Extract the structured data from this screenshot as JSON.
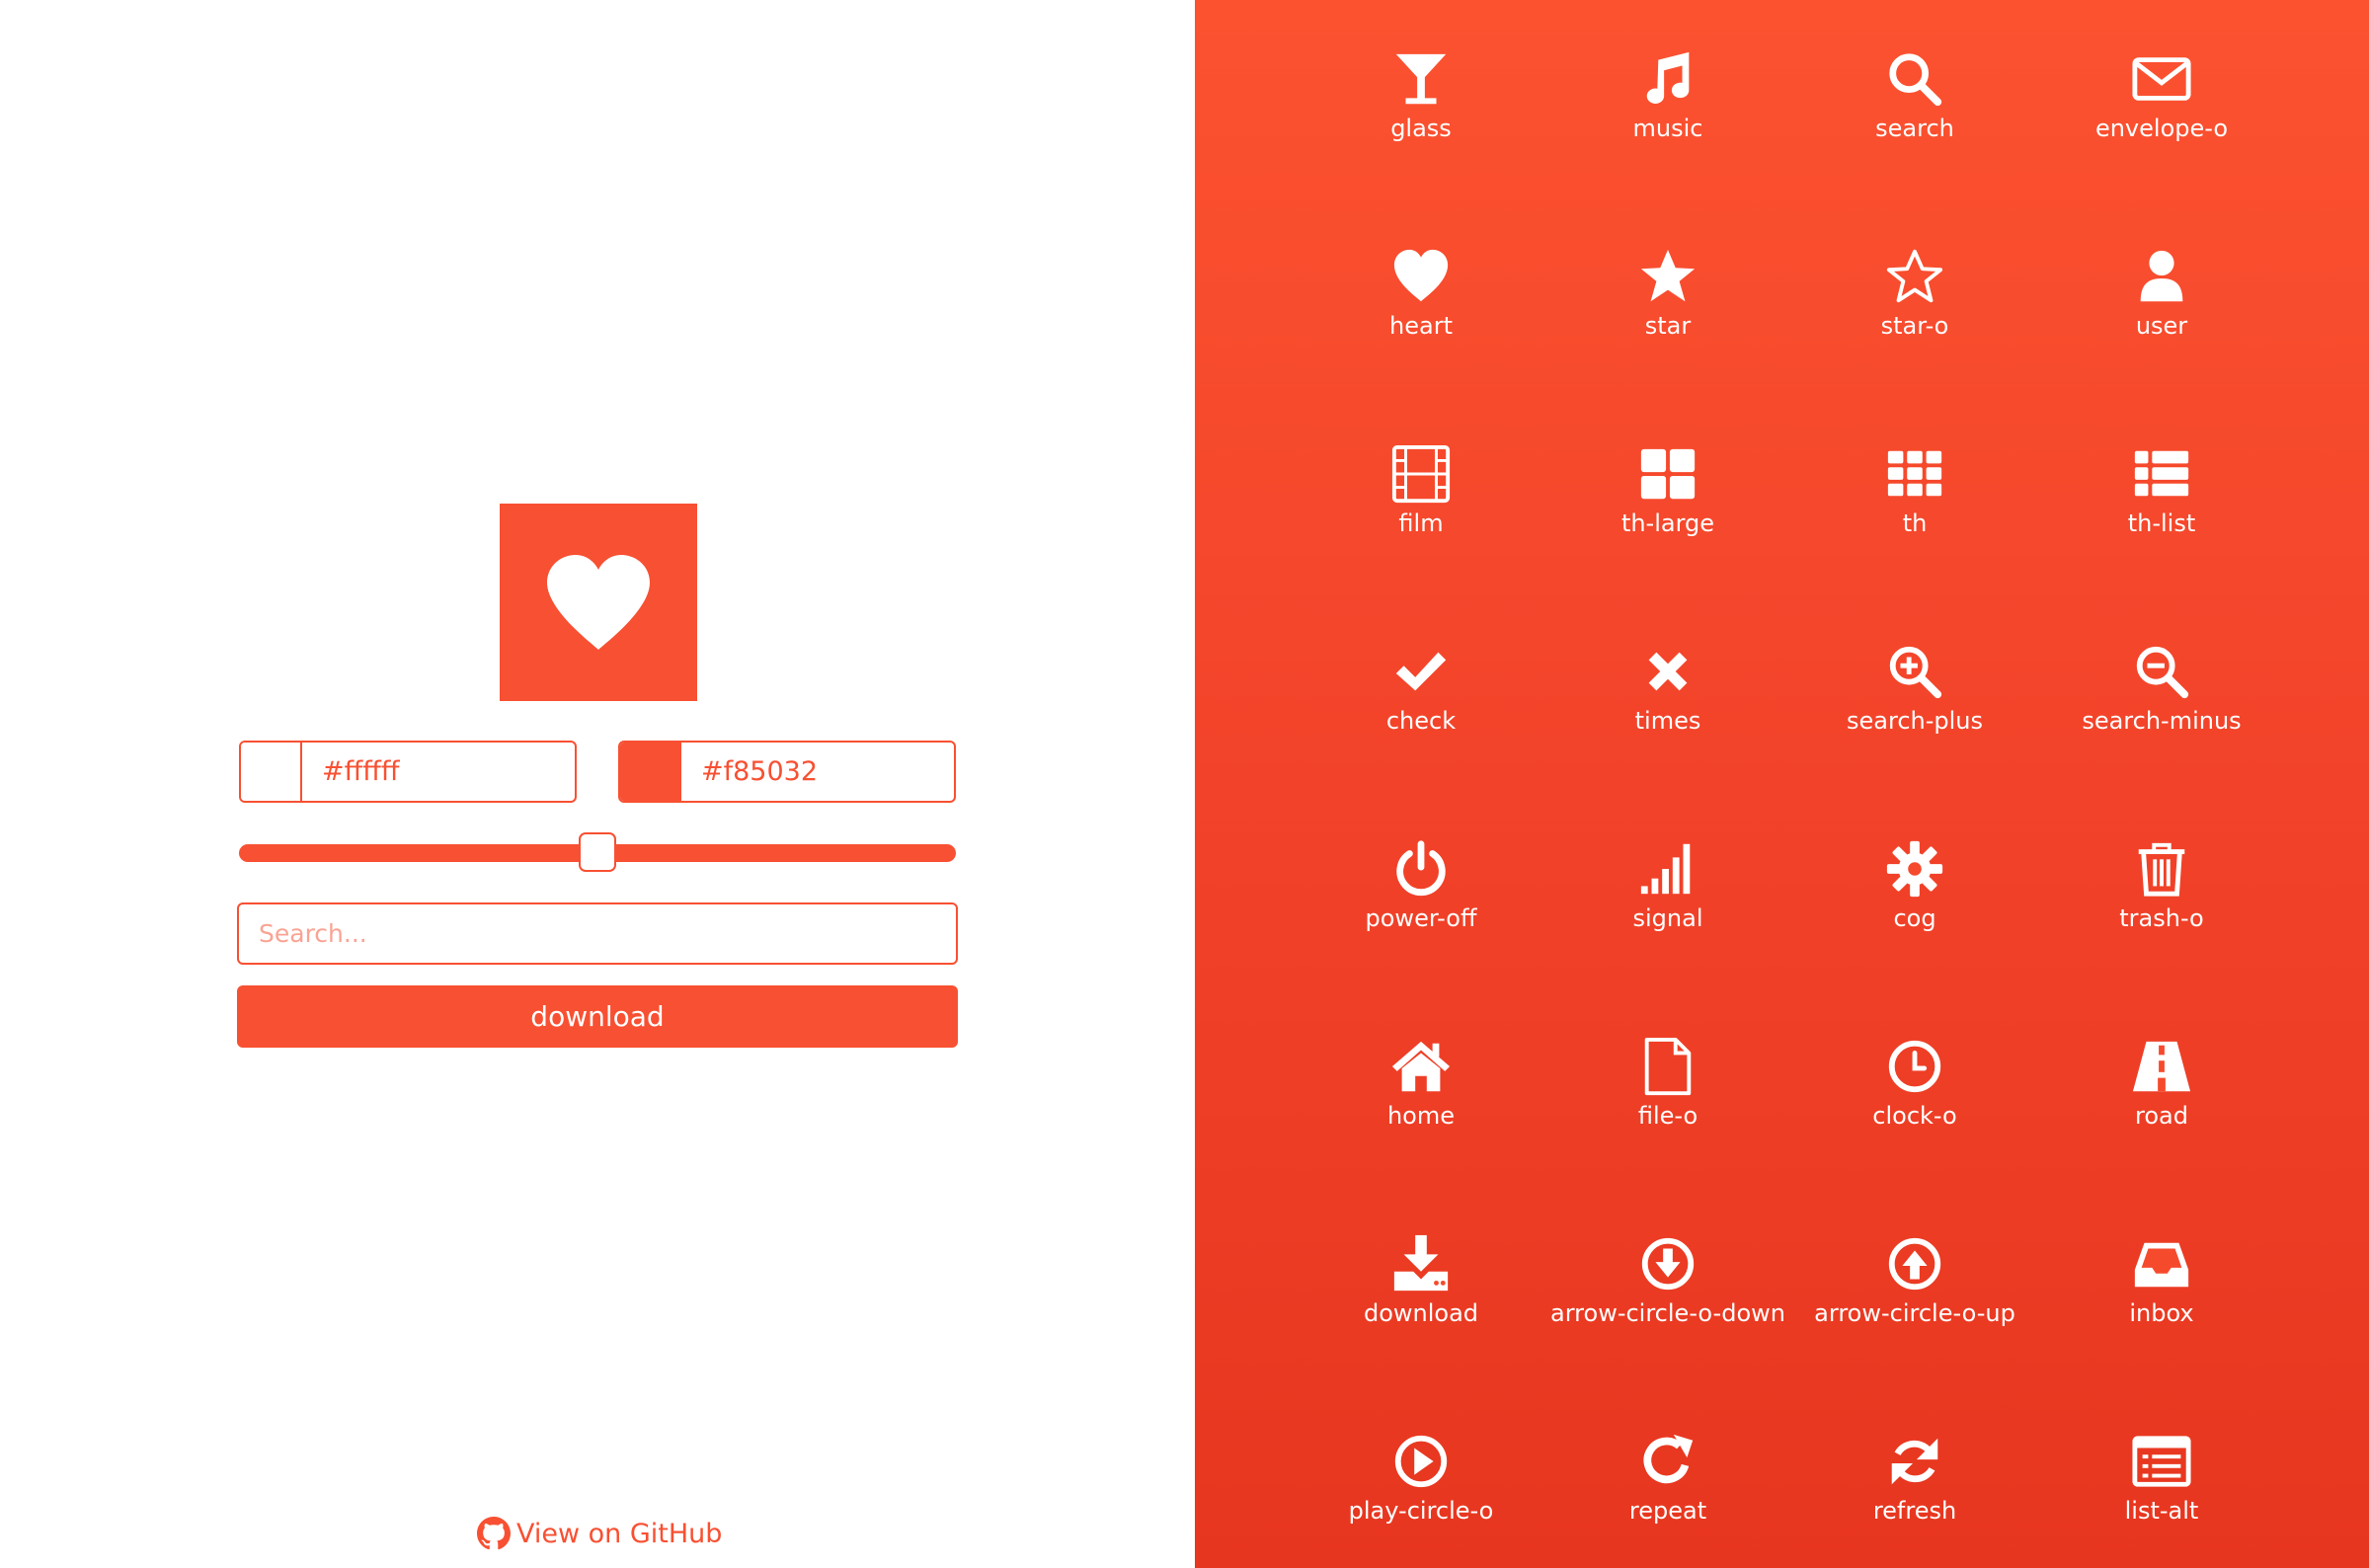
{
  "colors": {
    "accent": "#f85032",
    "foreground": "#ffffff",
    "background": "#f85032"
  },
  "preview": {
    "icon": "heart-icon"
  },
  "foreground_field": {
    "value": "#ffffff"
  },
  "background_field": {
    "value": "#f85032"
  },
  "size_slider": {
    "value_fraction": 0.5
  },
  "search": {
    "placeholder": "Search..."
  },
  "download_button": {
    "label": "download"
  },
  "github_link": {
    "label": "View on GitHub",
    "icon": "github-icon"
  },
  "icons": [
    {
      "label": "glass",
      "icon": "glass-icon"
    },
    {
      "label": "music",
      "icon": "music-icon"
    },
    {
      "label": "search",
      "icon": "search-icon"
    },
    {
      "label": "envelope-o",
      "icon": "envelope-o-icon"
    },
    {
      "label": "heart",
      "icon": "heart-icon"
    },
    {
      "label": "star",
      "icon": "star-icon"
    },
    {
      "label": "star-o",
      "icon": "star-o-icon"
    },
    {
      "label": "user",
      "icon": "user-icon"
    },
    {
      "label": "film",
      "icon": "film-icon"
    },
    {
      "label": "th-large",
      "icon": "th-large-icon"
    },
    {
      "label": "th",
      "icon": "th-icon"
    },
    {
      "label": "th-list",
      "icon": "th-list-icon"
    },
    {
      "label": "check",
      "icon": "check-icon"
    },
    {
      "label": "times",
      "icon": "times-icon"
    },
    {
      "label": "search-plus",
      "icon": "search-plus-icon"
    },
    {
      "label": "search-minus",
      "icon": "search-minus-icon"
    },
    {
      "label": "power-off",
      "icon": "power-off-icon"
    },
    {
      "label": "signal",
      "icon": "signal-icon"
    },
    {
      "label": "cog",
      "icon": "cog-icon"
    },
    {
      "label": "trash-o",
      "icon": "trash-o-icon"
    },
    {
      "label": "home",
      "icon": "home-icon"
    },
    {
      "label": "file-o",
      "icon": "file-o-icon"
    },
    {
      "label": "clock-o",
      "icon": "clock-o-icon"
    },
    {
      "label": "road",
      "icon": "road-icon"
    },
    {
      "label": "download",
      "icon": "download-icon"
    },
    {
      "label": "arrow-circle-o-down",
      "icon": "arrow-circle-o-down-icon"
    },
    {
      "label": "arrow-circle-o-up",
      "icon": "arrow-circle-o-up-icon"
    },
    {
      "label": "inbox",
      "icon": "inbox-icon"
    },
    {
      "label": "play-circle-o",
      "icon": "play-circle-o-icon"
    },
    {
      "label": "repeat",
      "icon": "repeat-icon"
    },
    {
      "label": "refresh",
      "icon": "refresh-icon"
    },
    {
      "label": "list-alt",
      "icon": "list-alt-icon"
    }
  ]
}
